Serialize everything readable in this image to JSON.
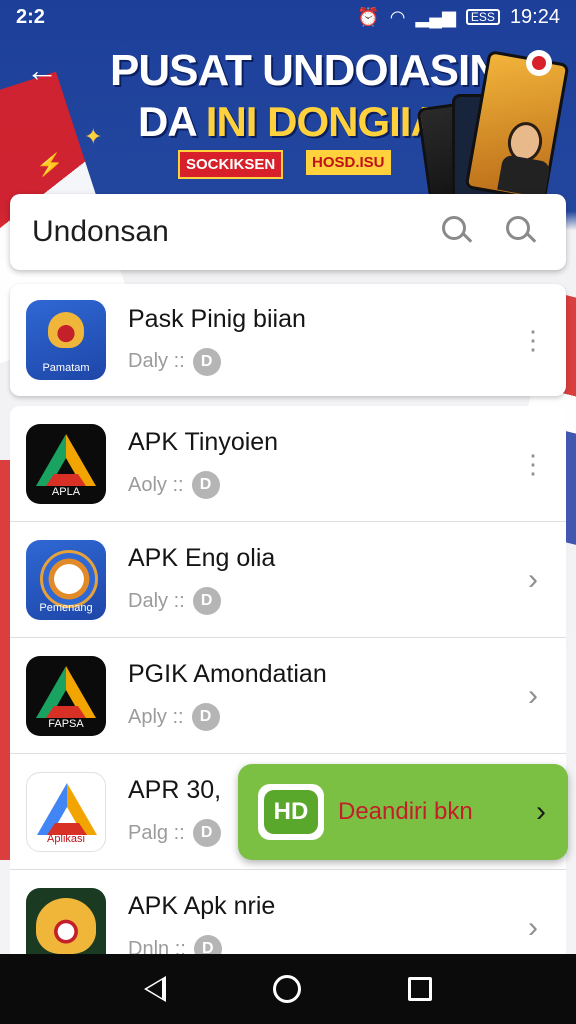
{
  "status_bar": {
    "time_left": "2:2",
    "time_right": "19:24",
    "battery_label": "ESS"
  },
  "banner": {
    "line1": "PUSAT UNDOIASIN",
    "line2_lead": "DA",
    "line2_rest": "INI DONGIIAO",
    "badge_red": "SOCKIKSEN",
    "badge_yellow": "HOSD.ISU"
  },
  "search": {
    "value": "Undonsan"
  },
  "apps": [
    {
      "name": "Pask Pinig biian",
      "sub": "Daly ::",
      "icon_caption": "Pamatam",
      "icon": "garuda-blue",
      "action": "kebab"
    },
    {
      "name": "APK Tinyoien",
      "sub": "Aoly ::",
      "icon_caption": "APLA",
      "icon": "drive-dark",
      "action": "kebab"
    },
    {
      "name": "APK Eng olia",
      "sub": "Daly ::",
      "icon_caption": "Pemenang",
      "icon": "emblem",
      "action": "chevron"
    },
    {
      "name": "PGIK Amondatian",
      "sub": "Aply ::",
      "icon_caption": "FAPSA",
      "icon": "drive-dark",
      "action": "chevron"
    },
    {
      "name": "APR 30,",
      "sub": "Palg ::",
      "icon_caption": "Aplikasi",
      "icon": "drive-light",
      "action": "chevron"
    },
    {
      "name": "APK Apk nrie",
      "sub": "Dnln ::",
      "icon_caption": "",
      "icon": "garuda-green",
      "action": "chevron"
    }
  ],
  "toast": {
    "logo_text": "HD",
    "label": "Deandiri bkn"
  },
  "icons": {
    "back": "arrow-left-icon",
    "search": "search-icon",
    "kebab": "more-vertical-icon",
    "chevron": "chevron-right-icon",
    "meta": "badge-icon"
  },
  "colors": {
    "banner_blue": "#1d3f9a",
    "accent_yellow": "#ffd23d",
    "toast_green": "#7bc043",
    "toast_text_red": "#c21f2a"
  }
}
